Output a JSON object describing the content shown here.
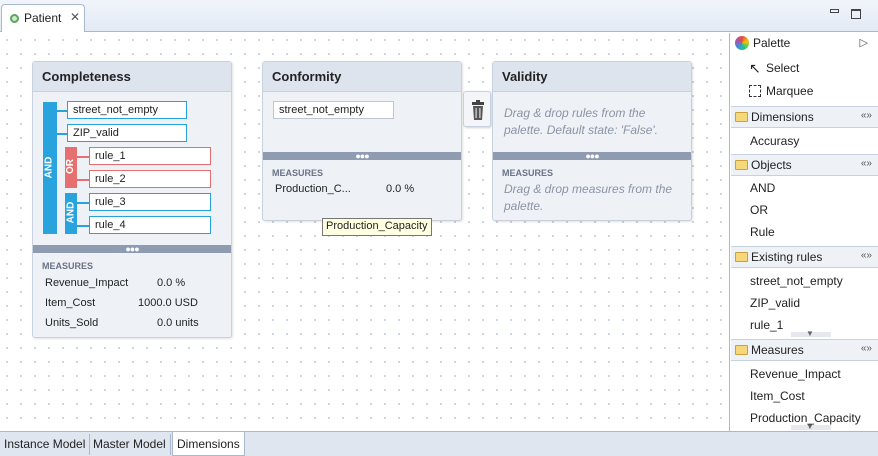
{
  "editor": {
    "tab_label": "Patient",
    "close_glyph": "✕"
  },
  "dimensions": [
    {
      "title": "Completeness",
      "rules": [
        "street_not_empty",
        "ZIP_valid",
        "rule_1",
        "rule_2",
        "rule_3",
        "rule_4"
      ],
      "operators": {
        "outer": "AND",
        "or": "OR",
        "inner_and": "AND"
      },
      "measures_label": "MEASURES",
      "measures": [
        {
          "name": "Revenue_Impact",
          "value": "0.0 %"
        },
        {
          "name": "Item_Cost",
          "value": "1000.0 USD"
        },
        {
          "name": "Units_Sold",
          "value": "0.0 units"
        }
      ]
    },
    {
      "title": "Conformity",
      "rules": [
        "street_not_empty"
      ],
      "measures_label": "MEASURES",
      "measures": [
        {
          "name": "Production_C...",
          "value": "0.0 %"
        }
      ]
    },
    {
      "title": "Validity",
      "rules_hint": "Drag & drop rules from the palette. Default state: 'False'.",
      "measures_label": "MEASURES",
      "measures_hint": "Drag & drop measures from the palette."
    }
  ],
  "separator_dots": "●●●",
  "tooltip": "Production_Capacity",
  "palette": {
    "title": "Palette",
    "tools": [
      "Select",
      "Marquee"
    ],
    "groups": [
      {
        "title": "Dimensions",
        "items": [
          "Accurasy"
        ]
      },
      {
        "title": "Objects",
        "items": [
          "AND",
          "OR",
          "Rule"
        ]
      },
      {
        "title": "Existing rules",
        "items": [
          "street_not_empty",
          "ZIP_valid",
          "rule_1"
        ]
      },
      {
        "title": "Measures",
        "items": [
          "Revenue_Impact",
          "Item_Cost",
          "Production_Capacity"
        ]
      }
    ],
    "collapse_glyph": "«»",
    "more_glyph": "▼"
  },
  "bottom_tabs": [
    "Instance Model",
    "Master Model",
    "Dimensions"
  ],
  "active_bottom_tab": "Dimensions",
  "colors": {
    "and": "#29a3de",
    "or": "#e6706f",
    "separator": "#8e9bb1"
  }
}
